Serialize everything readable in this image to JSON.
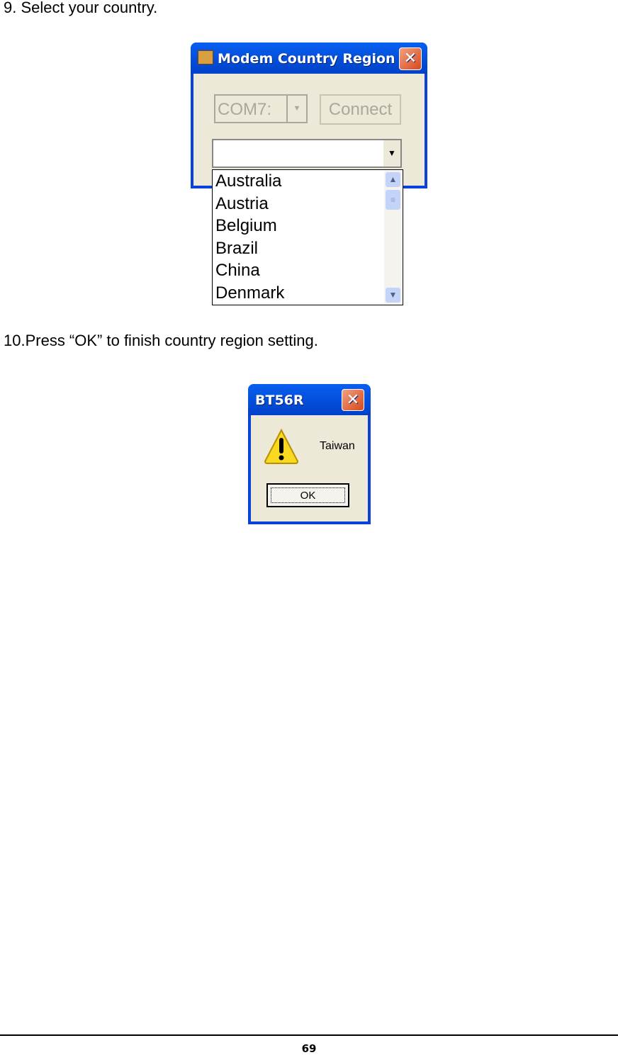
{
  "steps": {
    "step9": "9.  Select your country.",
    "step10": "10.Press “OK” to finish country region setting."
  },
  "modem_dialog": {
    "title": "Modem Country Region",
    "port_value": "COM7:",
    "connect_label": "Connect",
    "country_value": "",
    "countries": [
      "Australia",
      "Austria",
      "Belgium",
      "Brazil",
      "China",
      "Denmark"
    ]
  },
  "message_box": {
    "title": "BT56R",
    "message": "Taiwan",
    "ok_label": "OK",
    "icon": "warning-icon"
  },
  "footer": {
    "page_number": "69"
  },
  "colors": {
    "titlebar": "#0453E0",
    "window_body": "#ECE9D8",
    "close": "#D8481C"
  }
}
